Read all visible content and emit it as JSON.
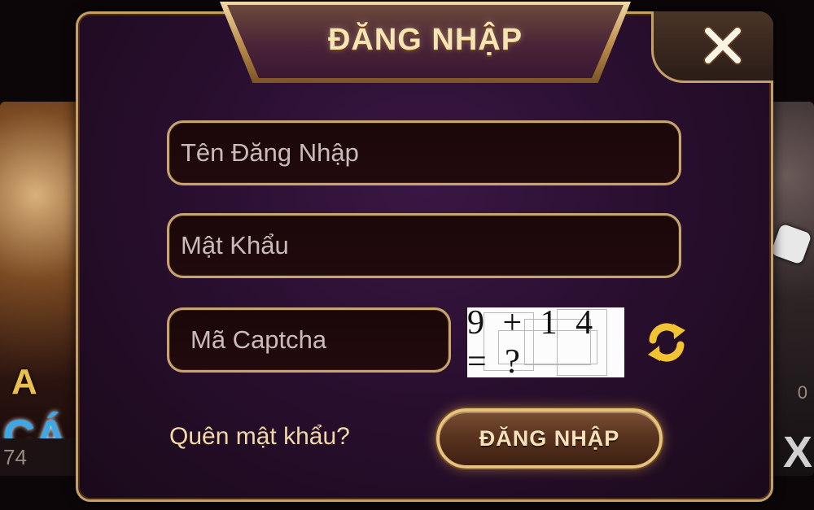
{
  "dialog": {
    "title": "ĐĂNG NHẬP",
    "close_icon": "close-icon"
  },
  "form": {
    "username_placeholder": "Tên Đăng Nhập",
    "password_placeholder": "Mật Khẩu",
    "captcha_placeholder": "Mã Captcha",
    "captcha_challenge": "9 + 1 4 = ?",
    "refresh_icon": "refresh-icon",
    "forgot_password": "Quên mật khẩu?",
    "login_button": "ĐĂNG NHẬP"
  },
  "background": {
    "left_card_count": "74",
    "left_card_text_a": "A",
    "left_card_text_ca": "CÁ",
    "right_card_count": "0",
    "right_card_text": "X"
  },
  "colors": {
    "gold_border": "#c4a068",
    "dialog_bg": "#2a0f30",
    "title_text": "#f7e4b4",
    "link_text": "#f2d8a6"
  }
}
